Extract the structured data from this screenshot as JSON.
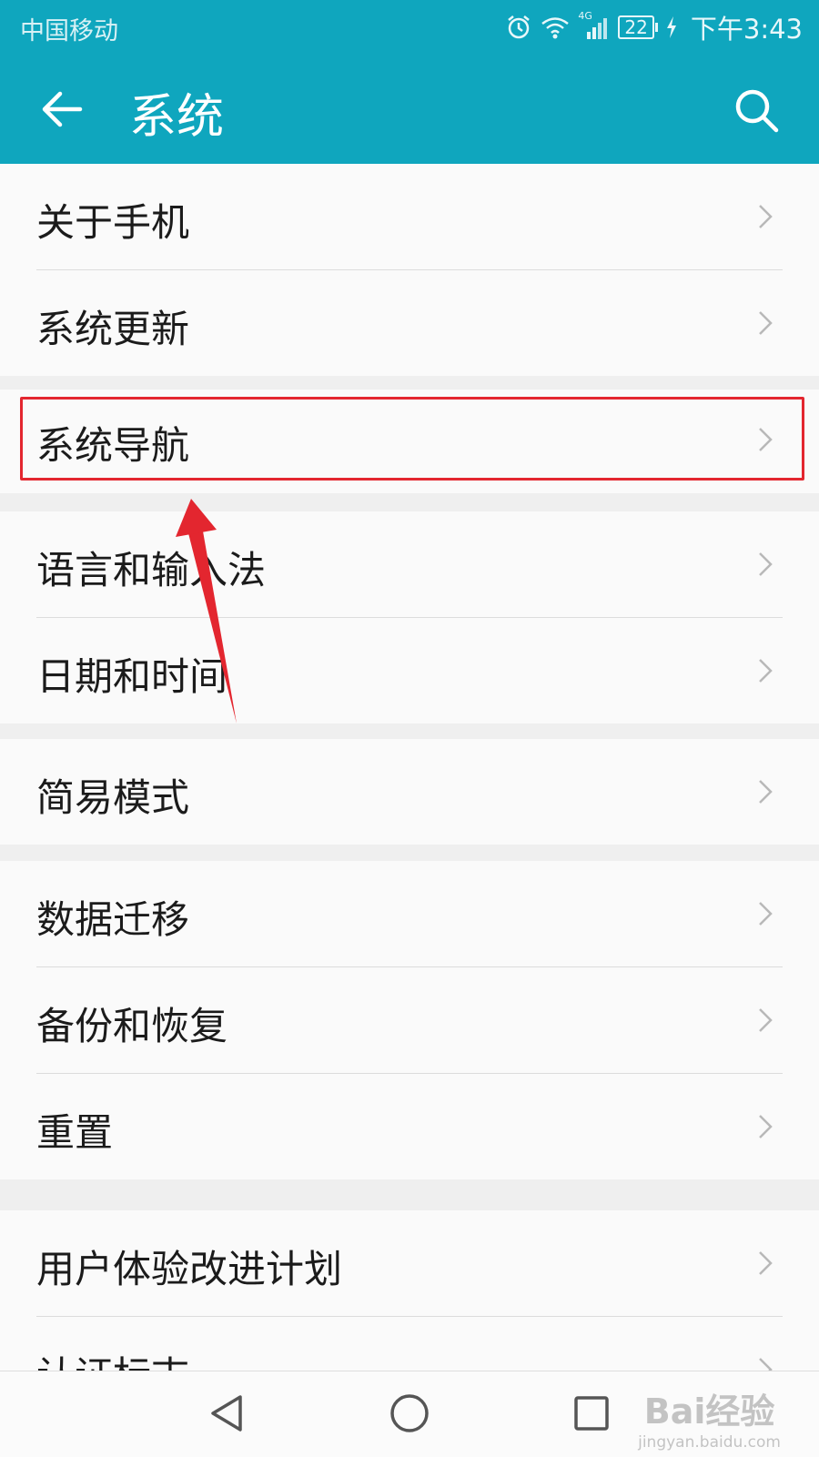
{
  "status_bar": {
    "carrier": "中国移动",
    "network": "4G",
    "battery": "22",
    "time": "下午3:43"
  },
  "app_bar": {
    "title": "系统"
  },
  "settings": {
    "groups": [
      {
        "items": [
          {
            "label": "关于手机"
          },
          {
            "label": "系统更新"
          }
        ]
      },
      {
        "items": [
          {
            "label": "系统导航"
          }
        ]
      },
      {
        "items": [
          {
            "label": "语言和输入法"
          },
          {
            "label": "日期和时间"
          }
        ]
      },
      {
        "items": [
          {
            "label": "简易模式"
          }
        ]
      },
      {
        "items": [
          {
            "label": "数据迁移"
          },
          {
            "label": "备份和恢复"
          },
          {
            "label": "重置"
          }
        ]
      },
      {
        "items": [
          {
            "label": "用户体验改进计划"
          },
          {
            "label": "认证标志"
          }
        ]
      }
    ]
  },
  "watermark": {
    "brand": "Bai经验",
    "url": "jingyan.baidu.com"
  },
  "colors": {
    "accent": "#0fa6be",
    "highlight": "#e3262f"
  }
}
